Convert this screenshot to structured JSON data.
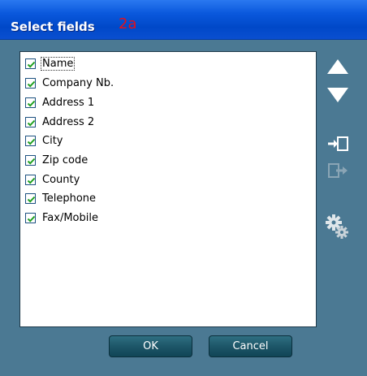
{
  "window": {
    "title": "Select fields",
    "tag": "2a"
  },
  "fields": [
    {
      "label": "Name",
      "checked": true
    },
    {
      "label": "Company Nb.",
      "checked": true
    },
    {
      "label": "Address 1",
      "checked": true
    },
    {
      "label": "Address 2",
      "checked": true
    },
    {
      "label": "City",
      "checked": true
    },
    {
      "label": "Zip code",
      "checked": true
    },
    {
      "label": "County",
      "checked": true
    },
    {
      "label": "Telephone",
      "checked": true
    },
    {
      "label": "Fax/Mobile",
      "checked": true
    }
  ],
  "side_buttons": [
    "arrow-up-icon",
    "arrow-down-icon",
    "import-icon",
    "export-icon",
    "settings-gears-icon"
  ],
  "buttons": {
    "ok": "OK",
    "cancel": "Cancel"
  },
  "colors": {
    "accent": "#0a58dc",
    "panel": "#4b7993",
    "button": "#1d5668",
    "tag": "#e4101a"
  }
}
